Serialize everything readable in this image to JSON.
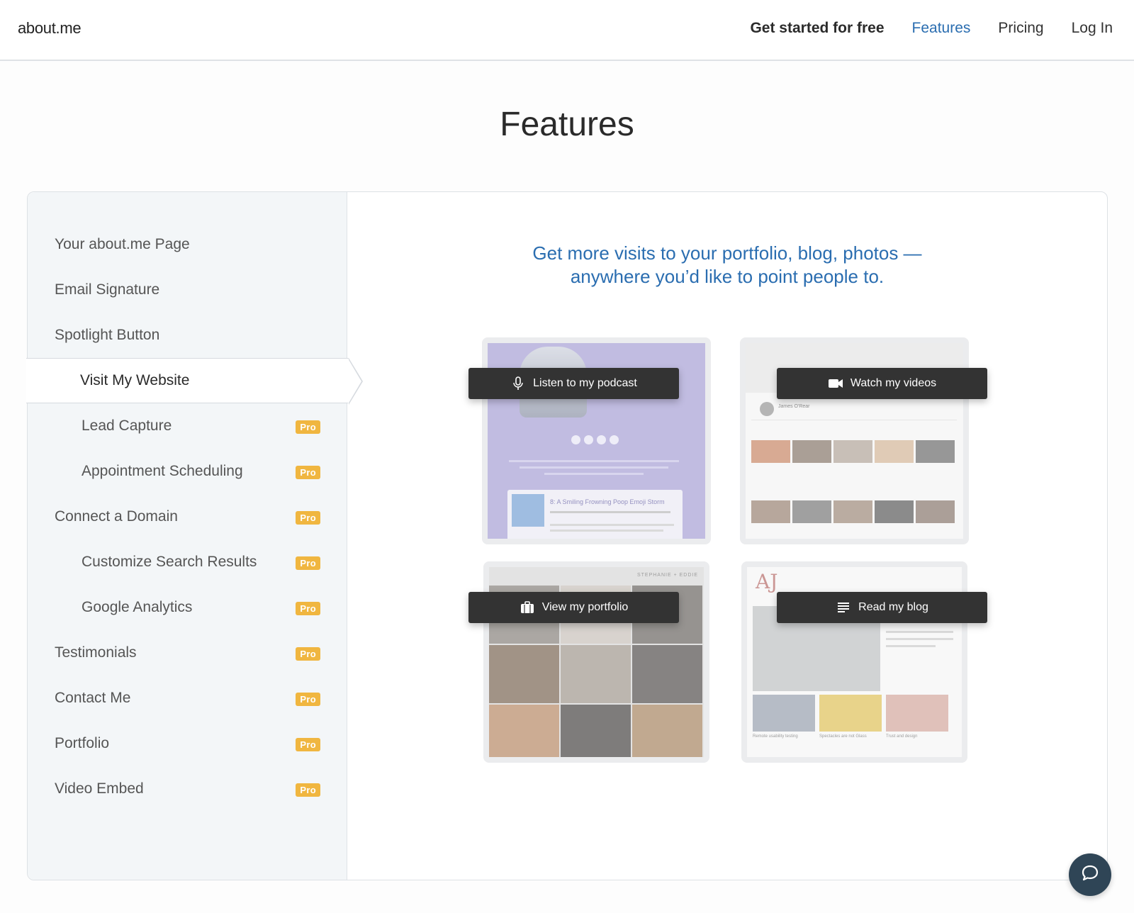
{
  "brand": {
    "logo": "about.me"
  },
  "nav": {
    "get_started": "Get started for free",
    "features": "Features",
    "pricing": "Pricing",
    "login": "Log In"
  },
  "page": {
    "title": "Features"
  },
  "sidebar": {
    "items": [
      {
        "label": "Your about.me Page",
        "pro": ""
      },
      {
        "label": "Email Signature",
        "pro": ""
      },
      {
        "label": "Spotlight Button",
        "pro": ""
      },
      {
        "label": "Visit My Website",
        "pro": ""
      },
      {
        "label": "Lead Capture",
        "pro": "Pro"
      },
      {
        "label": "Appointment Scheduling",
        "pro": "Pro"
      },
      {
        "label": "Connect a Domain",
        "pro": "Pro"
      },
      {
        "label": "Customize Search Results",
        "pro": "Pro"
      },
      {
        "label": "Google Analytics",
        "pro": "Pro"
      },
      {
        "label": "Testimonials",
        "pro": "Pro"
      },
      {
        "label": "Contact Me",
        "pro": "Pro"
      },
      {
        "label": "Portfolio",
        "pro": "Pro"
      },
      {
        "label": "Video Embed",
        "pro": "Pro"
      }
    ]
  },
  "main": {
    "tagline_line1": "Get more visits to your portfolio, blog, photos —",
    "tagline_line2": "anywhere you’d like to point people to.",
    "buttons": {
      "podcast": "Listen to my podcast",
      "videos": "Watch my videos",
      "portfolio": "View my portfolio",
      "blog": "Read my blog"
    },
    "preview_podcast_episode": "8: A Smiling Frowning Poop Emoji Storm",
    "preview_videos_channel": "James O'Rear",
    "preview_portfolio_name": "STEPHANIE + EDDIE",
    "preview_blog_logo": "AJ",
    "preview_blog_captions": [
      "Remote usability testing",
      "Spectacles are not Glass",
      "Trust and design"
    ]
  },
  "colors": {
    "accent": "#2a6db0",
    "pro_badge": "#f0b640",
    "pill": "#333333",
    "chat": "#2f4556"
  },
  "icons": [
    "microphone-icon",
    "video-camera-icon",
    "briefcase-icon",
    "list-lines-icon",
    "chat-bubble-icon"
  ]
}
